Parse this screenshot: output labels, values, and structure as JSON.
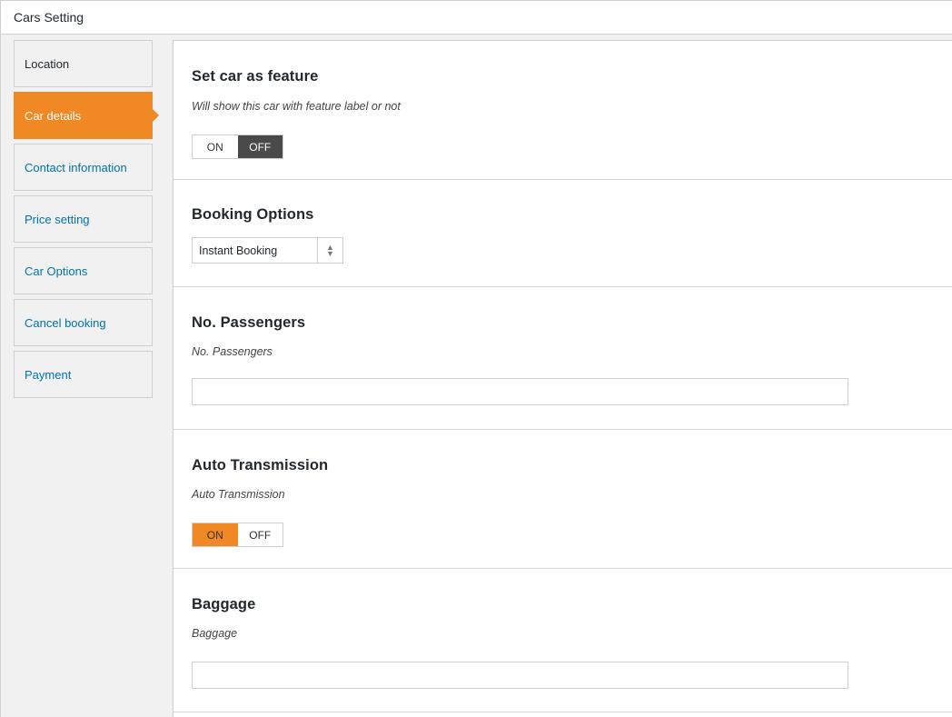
{
  "header": {
    "title": "Cars Setting"
  },
  "sidebar": {
    "items": [
      {
        "label": "Location"
      },
      {
        "label": "Car details"
      },
      {
        "label": "Contact information"
      },
      {
        "label": "Price setting"
      },
      {
        "label": "Car Options"
      },
      {
        "label": "Cancel booking"
      },
      {
        "label": "Payment"
      }
    ]
  },
  "sections": {
    "feature": {
      "title": "Set car as feature",
      "description": "Will show this car with feature label or not",
      "on_label": "ON",
      "off_label": "OFF",
      "selected": "OFF"
    },
    "booking": {
      "title": "Booking Options",
      "selected_option": "Instant Booking"
    },
    "passengers": {
      "title": "No. Passengers",
      "description": "No. Passengers",
      "value": ""
    },
    "transmission": {
      "title": "Auto Transmission",
      "description": "Auto Transmission",
      "on_label": "ON",
      "off_label": "OFF",
      "selected": "ON"
    },
    "baggage": {
      "title": "Baggage",
      "description": "Baggage",
      "value": ""
    }
  },
  "colors": {
    "accent": "#f08923",
    "link": "#0073aa",
    "dark_toggle": "#4a4a4a"
  },
  "icons": {
    "select_arrows": "sort-arrows-icon"
  }
}
